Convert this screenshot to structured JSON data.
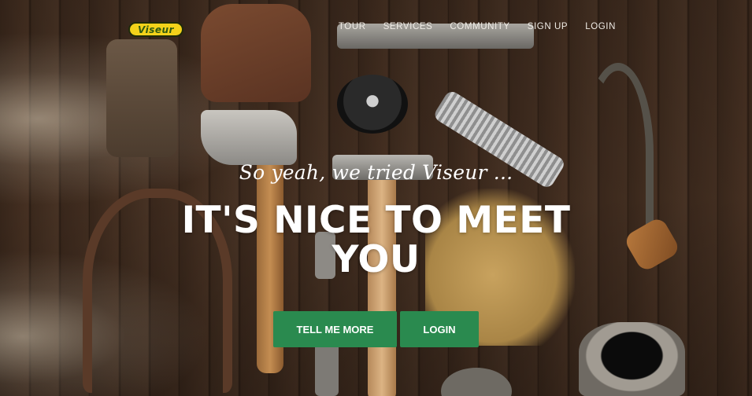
{
  "navbar": {
    "brand": "Viseur",
    "links": [
      {
        "label": "TOUR"
      },
      {
        "label": "SERVICES"
      },
      {
        "label": "COMMUNITY"
      },
      {
        "label": "SIGN UP"
      },
      {
        "label": "LOGIN"
      }
    ]
  },
  "hero": {
    "lead": "So yeah, we tried Viseur ...",
    "headline": "IT'S NICE TO MEET YOU",
    "buttons": {
      "primary": "TELL ME MORE",
      "secondary": "LOGIN"
    }
  },
  "colors": {
    "accent": "#2a8a4f",
    "brand_bg": "#f3d21a",
    "brand_text": "#2f5a12"
  }
}
